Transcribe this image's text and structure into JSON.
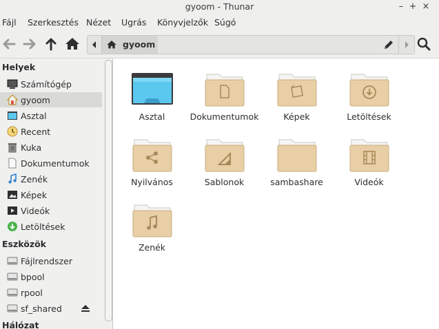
{
  "window": {
    "title": "gyoom - Thunar",
    "controls": [
      "–",
      "+",
      "×"
    ]
  },
  "menubar": {
    "items": [
      "Fájl",
      "Szerkesztés",
      "Nézet",
      "Ugrás",
      "Könyvjelzők",
      "Súgó"
    ]
  },
  "toolbar": {
    "back_icon": "arrow-left-icon",
    "forward_icon": "arrow-right-icon",
    "up_icon": "arrow-up-icon",
    "home_icon": "home-icon",
    "search_icon": "search-icon"
  },
  "location": {
    "current": "gyoom"
  },
  "sidebar": {
    "sections": [
      {
        "title": "Helyek",
        "items": [
          {
            "label": "Számítógép",
            "icon": "computer-icon"
          },
          {
            "label": "gyoom",
            "icon": "home-icon",
            "active": true
          },
          {
            "label": "Asztal",
            "icon": "desktop-icon"
          },
          {
            "label": "Recent",
            "icon": "recent-icon"
          },
          {
            "label": "Kuka",
            "icon": "trash-icon"
          },
          {
            "label": "Dokumentumok",
            "icon": "documents-icon"
          },
          {
            "label": "Zenék",
            "icon": "music-icon"
          },
          {
            "label": "Képek",
            "icon": "pictures-icon"
          },
          {
            "label": "Videók",
            "icon": "videos-icon"
          },
          {
            "label": "Letöltések",
            "icon": "downloads-icon"
          }
        ]
      },
      {
        "title": "Eszközök",
        "items": [
          {
            "label": "Fájlrendszer",
            "icon": "drive-icon"
          },
          {
            "label": "bpool",
            "icon": "drive-icon"
          },
          {
            "label": "rpool",
            "icon": "drive-icon"
          },
          {
            "label": "sf_shared",
            "icon": "drive-icon",
            "eject": true
          }
        ]
      },
      {
        "title": "Hálózat",
        "items": []
      }
    ]
  },
  "files": [
    {
      "name": "Asztal",
      "icon": "desktop-folder-icon"
    },
    {
      "name": "Dokumentumok",
      "icon": "documents-folder-icon"
    },
    {
      "name": "Képek",
      "icon": "pictures-folder-icon"
    },
    {
      "name": "Letöltések",
      "icon": "downloads-folder-icon"
    },
    {
      "name": "Nyilvános",
      "icon": "public-folder-icon"
    },
    {
      "name": "Sablonok",
      "icon": "templates-folder-icon"
    },
    {
      "name": "sambashare",
      "icon": "folder-icon"
    },
    {
      "name": "Videók",
      "icon": "videos-folder-icon"
    },
    {
      "name": "Zenék",
      "icon": "music-folder-icon"
    }
  ],
  "colors": {
    "folder": "#e8cfa5",
    "folder_back": "#f5f5f3",
    "desktop_blue": "#5bc8f0",
    "accent_green": "#4bb34b"
  }
}
